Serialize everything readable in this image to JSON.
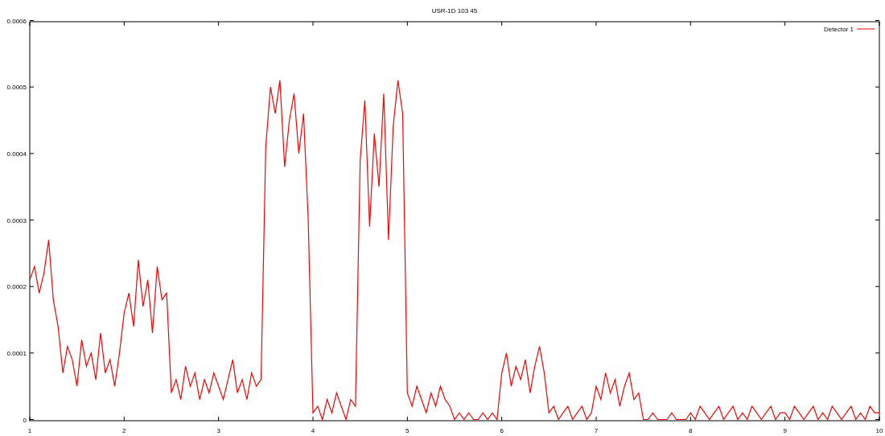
{
  "chart_data": {
    "type": "line",
    "title": "USR-1D 103 45",
    "xlim": [
      1,
      10
    ],
    "ylim": [
      0,
      0.0006
    ],
    "xticks": [
      1,
      2,
      3,
      4,
      5,
      6,
      7,
      8,
      9,
      10
    ],
    "yticks": [
      0,
      0.0001,
      0.0002,
      0.0003,
      0.0004,
      0.0005,
      0.0006
    ],
    "x": [
      1,
      1.05,
      1.1,
      1.15,
      1.2,
      1.25,
      1.3,
      1.35,
      1.4,
      1.45,
      1.5,
      1.55,
      1.6,
      1.65,
      1.7,
      1.75,
      1.8,
      1.85,
      1.9,
      1.95,
      2,
      2.05,
      2.1,
      2.15,
      2.2,
      2.25,
      2.3,
      2.35,
      2.4,
      2.45,
      2.5,
      2.55,
      2.6,
      2.65,
      2.7,
      2.75,
      2.8,
      2.85,
      2.9,
      2.95,
      3,
      3.05,
      3.1,
      3.15,
      3.2,
      3.25,
      3.3,
      3.35,
      3.4,
      3.45,
      3.5,
      3.55,
      3.6,
      3.65,
      3.7,
      3.75,
      3.8,
      3.85,
      3.9,
      3.95,
      4,
      4.05,
      4.1,
      4.15,
      4.2,
      4.25,
      4.3,
      4.35,
      4.4,
      4.45,
      4.5,
      4.55,
      4.6,
      4.65,
      4.7,
      4.75,
      4.8,
      4.85,
      4.9,
      4.95,
      5,
      5.05,
      5.1,
      5.15,
      5.2,
      5.25,
      5.3,
      5.35,
      5.4,
      5.45,
      5.5,
      5.55,
      5.6,
      5.65,
      5.7,
      5.75,
      5.8,
      5.85,
      5.9,
      5.95,
      6,
      6.05,
      6.1,
      6.15,
      6.2,
      6.25,
      6.3,
      6.35,
      6.4,
      6.45,
      6.5,
      6.55,
      6.6,
      6.65,
      6.7,
      6.75,
      6.8,
      6.85,
      6.9,
      6.95,
      7,
      7.05,
      7.1,
      7.15,
      7.2,
      7.25,
      7.3,
      7.35,
      7.4,
      7.45,
      7.5,
      7.55,
      7.6,
      7.65,
      7.7,
      7.75,
      7.8,
      7.85,
      7.9,
      7.95,
      8,
      8.05,
      8.1,
      8.15,
      8.2,
      8.25,
      8.3,
      8.35,
      8.4,
      8.45,
      8.5,
      8.55,
      8.6,
      8.65,
      8.7,
      8.75,
      8.8,
      8.85,
      8.9,
      8.95,
      9,
      9.05,
      9.1,
      9.15,
      9.2,
      9.25,
      9.3,
      9.35,
      9.4,
      9.45,
      9.5,
      9.55,
      9.6,
      9.65,
      9.7,
      9.75,
      9.8,
      9.85,
      9.9,
      9.95,
      10
    ],
    "series": [
      {
        "name": "Detector 1",
        "color": "#ff0000",
        "values": [
          0.00021,
          0.00023,
          0.00019,
          0.00022,
          0.00027,
          0.00018,
          0.00014,
          7e-05,
          0.00011,
          9e-05,
          5e-05,
          0.00012,
          8e-05,
          0.0001,
          6e-05,
          0.00013,
          7e-05,
          9e-05,
          5e-05,
          0.0001,
          0.00016,
          0.00019,
          0.00014,
          0.00024,
          0.00017,
          0.00021,
          0.00013,
          0.00023,
          0.00018,
          0.00019,
          4e-05,
          6e-05,
          3e-05,
          8e-05,
          5e-05,
          7e-05,
          3e-05,
          6e-05,
          4e-05,
          7e-05,
          5e-05,
          3e-05,
          6e-05,
          9e-05,
          4e-05,
          6e-05,
          3e-05,
          7e-05,
          5e-05,
          6e-05,
          0.00041,
          0.0005,
          0.00046,
          0.00051,
          0.00038,
          0.00045,
          0.00049,
          0.0004,
          0.00046,
          0.0003,
          1e-05,
          2e-05,
          0,
          3e-05,
          1e-05,
          4e-05,
          2e-05,
          0,
          3e-05,
          2e-05,
          0.00039,
          0.00048,
          0.00029,
          0.00043,
          0.00035,
          0.00049,
          0.00027,
          0.00044,
          0.00051,
          0.00046,
          4e-05,
          2e-05,
          5e-05,
          3e-05,
          1e-05,
          4e-05,
          2e-05,
          5e-05,
          3e-05,
          2e-05,
          0,
          1e-05,
          0,
          1e-05,
          0,
          0,
          1e-05,
          0,
          1e-05,
          0,
          7e-05,
          0.0001,
          5e-05,
          8e-05,
          6e-05,
          9e-05,
          4e-05,
          8e-05,
          0.00011,
          7e-05,
          1e-05,
          2e-05,
          0,
          1e-05,
          2e-05,
          0,
          1e-05,
          2e-05,
          0,
          1e-05,
          5e-05,
          3e-05,
          7e-05,
          4e-05,
          6e-05,
          2e-05,
          5e-05,
          7e-05,
          3e-05,
          4e-05,
          0,
          0,
          1e-05,
          0,
          0,
          0,
          1e-05,
          0,
          0,
          0,
          1e-05,
          0,
          2e-05,
          1e-05,
          0,
          1e-05,
          2e-05,
          0,
          1e-05,
          2e-05,
          0,
          1e-05,
          0,
          2e-05,
          1e-05,
          0,
          1e-05,
          2e-05,
          0,
          1e-05,
          1e-05,
          0,
          2e-05,
          1e-05,
          0,
          1e-05,
          2e-05,
          0,
          1e-05,
          0,
          2e-05,
          1e-05,
          0,
          1e-05,
          2e-05,
          0,
          1e-05,
          0,
          2e-05,
          1e-05,
          1e-05
        ]
      }
    ]
  }
}
